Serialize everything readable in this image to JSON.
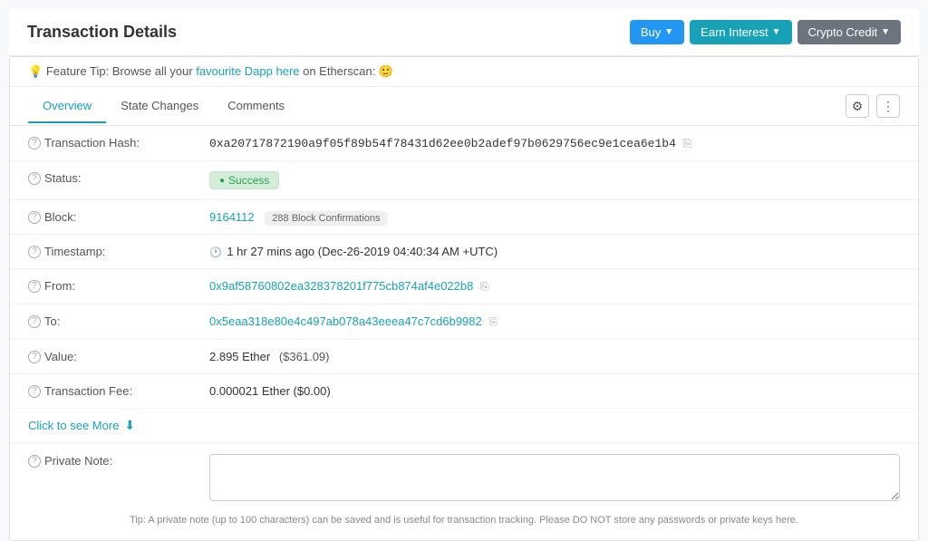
{
  "header": {
    "title": "Transaction Details",
    "buttons": [
      {
        "label": "Buy",
        "type": "buy"
      },
      {
        "label": "Earn Interest",
        "type": "earn"
      },
      {
        "label": "Crypto Credit",
        "type": "crypto"
      }
    ]
  },
  "feature_tip": {
    "prefix": "Feature Tip: Browse all your ",
    "link_text": "favourite Dapp here",
    "suffix": " on Etherscan: 🙂"
  },
  "tabs": {
    "items": [
      {
        "label": "Overview",
        "active": true
      },
      {
        "label": "State Changes",
        "active": false
      },
      {
        "label": "Comments",
        "active": false
      }
    ]
  },
  "details": {
    "transaction_hash": {
      "label": "Transaction Hash:",
      "value": "0xa20717872190a9f05f89b54f78431d62ee0b2adef97b0629756ec9e1cea6e1b4"
    },
    "status": {
      "label": "Status:",
      "value": "Success"
    },
    "block": {
      "label": "Block:",
      "number": "9164112",
      "confirmations": "288 Block Confirmations"
    },
    "timestamp": {
      "label": "Timestamp:",
      "value": "1 hr 27 mins ago (Dec-26-2019 04:40:34 AM +UTC)"
    },
    "from": {
      "label": "From:",
      "value": "0x9af58760802ea328378201f775cb874af4e022b8"
    },
    "to": {
      "label": "To:",
      "value": "0x5eaa318e80e4c497ab078a43eeea47c7cd6b9982"
    },
    "value": {
      "label": "Value:",
      "amount": "2.895 Ether",
      "usd": "($361.09)"
    },
    "transaction_fee": {
      "label": "Transaction Fee:",
      "value": "0.000021 Ether ($0.00)"
    }
  },
  "click_to_see_more": "Click to see More",
  "private_note": {
    "label": "Private Note:",
    "placeholder": "",
    "tip": "Tip: A private note (up to 100 characters) can be saved and is useful for transaction tracking. Please DO NOT store any passwords or private keys here."
  }
}
